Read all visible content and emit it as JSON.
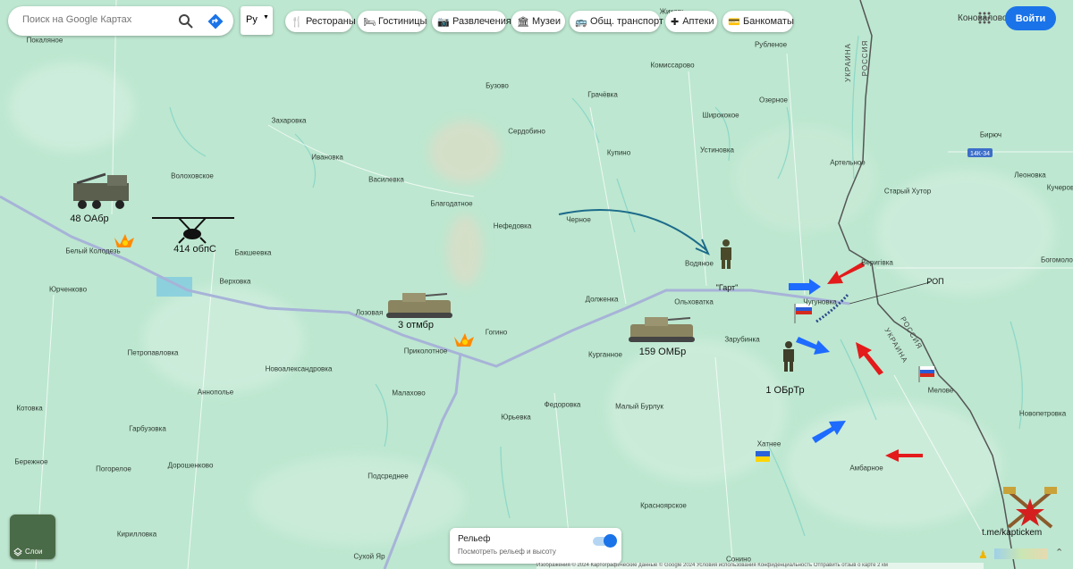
{
  "search": {
    "placeholder": "Поиск на Google Картах"
  },
  "language": {
    "value": "Ру"
  },
  "chips": [
    {
      "label": "Рестораны",
      "icon": "restaurant-icon"
    },
    {
      "label": "Гостиницы",
      "icon": "hotel-icon"
    },
    {
      "label": "Развлечения",
      "icon": "camera-icon"
    },
    {
      "label": "Музеи",
      "icon": "museum-icon"
    },
    {
      "label": "Общ. транспорт",
      "icon": "transit-icon"
    },
    {
      "label": "Аптеки",
      "icon": "pharmacy-icon"
    },
    {
      "label": "Банкоматы",
      "icon": "atm-icon"
    }
  ],
  "header": {
    "user_location": "Коновалово",
    "login_label": "Войти"
  },
  "layers": {
    "label": "Слои"
  },
  "relief": {
    "title": "Рельеф",
    "subtitle": "Посмотреть рельеф и высоту",
    "enabled": true
  },
  "border_labels": {
    "ukraine": "УКРАИНА",
    "russia": "РОССИЯ"
  },
  "road_badge": "14К-34",
  "places": [
    "Покаляное",
    "Захаровка",
    "Бузово",
    "Комиссарово",
    "Рубленое",
    "Грачёвка",
    "Ширококое",
    "Озерное",
    "Ивановка",
    "Сердобино",
    "Купино",
    "Устиновка",
    "Волоховское",
    "Василевка",
    "Благодатное",
    "Артельное",
    "Бирюч",
    "Леоновка",
    "Старый Хутор",
    "Кучеров",
    "Нефедовка",
    "Черное",
    "Белый Колодезь",
    "Бакшеевка",
    "Веригівка",
    "Богомолов",
    "Водяное",
    "Юрченково",
    "Верховка",
    "Ольховатка",
    "Чугуновка",
    "Лозовая",
    "Долженка",
    "Гогино",
    "Зарубинка",
    "Петропавловка",
    "Приколотное",
    "Курганное",
    "Новоалександровка",
    "Мелове",
    "Аннополье",
    "Малахово",
    "Федоровка",
    "Малый Бурлук",
    "Новопетровка",
    "Котовка",
    "Юрьевка",
    "Хатнее",
    "Гарбузовка",
    "Амбарное",
    "Бережное",
    "Погорелое",
    "Дорошенково",
    "Подсреднее",
    "Красноярское",
    "Кирилловка",
    "Сухой Яр",
    "Сонино",
    "Жихорь"
  ],
  "overlay_labels": {
    "unit_48": "48 ОАбр",
    "unit_414": "414 обпС",
    "unit_3": "3 отмбр",
    "unit_159": "159 ОМБр",
    "unit_1": "1 ОБрТр",
    "unit_gart": "\"Гарт\"",
    "rop": "РОП",
    "channel": "t.me/kaptickem"
  },
  "footer": "Изображения © 2024 Картографические данные © Google 2024   Условия использования   Конфиденциальность   Отправить отзыв о карте   2 км",
  "colors": {
    "map_bg": "#bfe9d3",
    "road": "#a7b3d8",
    "accent": "#1a73e8",
    "friendly_arrow": "#1e6bff",
    "enemy_arrow": "#e31b1b",
    "border": "#444444"
  }
}
